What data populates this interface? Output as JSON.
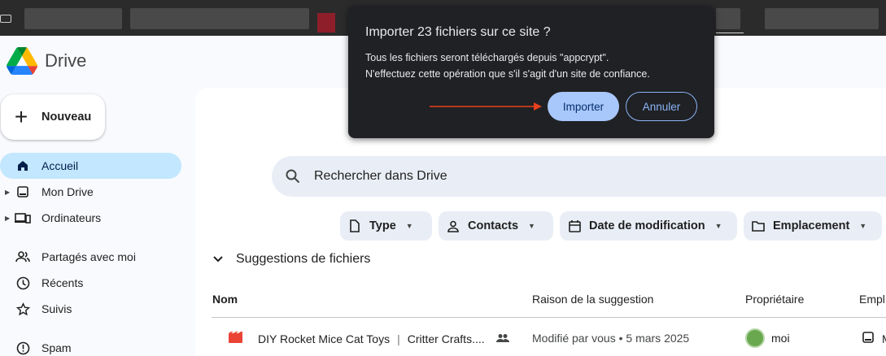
{
  "app": {
    "name": "Drive"
  },
  "sidebar": {
    "new_label": "Nouveau",
    "items": [
      {
        "label": "Accueil",
        "icon": "home-icon",
        "active": true
      },
      {
        "label": "Mon Drive",
        "icon": "my-drive-icon"
      },
      {
        "label": "Ordinateurs",
        "icon": "computers-icon"
      },
      {
        "label": "Partagés avec moi",
        "icon": "people-icon"
      },
      {
        "label": "Récents",
        "icon": "clock-icon"
      },
      {
        "label": "Suivis",
        "icon": "star-icon"
      },
      {
        "label": "Spam",
        "icon": "alert-icon"
      }
    ]
  },
  "search": {
    "placeholder": "Rechercher dans Drive"
  },
  "filters": [
    {
      "label": "Type",
      "icon": "file-icon"
    },
    {
      "label": "Contacts",
      "icon": "person-icon"
    },
    {
      "label": "Date de modification",
      "icon": "calendar-icon"
    },
    {
      "label": "Emplacement",
      "icon": "folder-icon"
    }
  ],
  "suggestions": {
    "title": "Suggestions de fichiers",
    "columns": [
      "Nom",
      "Raison de la suggestion",
      "Propriétaire",
      "Empl"
    ],
    "rows": [
      {
        "name": "DIY Rocket Mice Cat Toys",
        "separator": "|",
        "name2": "Critter Crafts....",
        "reason": "Modifié par vous • 5 mars 2025",
        "owner": "moi",
        "location": "M"
      }
    ]
  },
  "dialog": {
    "title": "Importer 23 fichiers sur ce site ?",
    "message_line1": "Tous les fichiers seront téléchargés depuis \"appcrypt\".",
    "message_line2": "N'effectuez cette opération que s'il s'agit d'un site de confiance.",
    "import_label": "Importer",
    "cancel_label": "Annuler"
  },
  "colors": {
    "active_nav": "#c2e7ff",
    "dialog_bg": "#202124",
    "import_button": "#a8c7fa",
    "annotation_arrow": "#e8401c"
  }
}
